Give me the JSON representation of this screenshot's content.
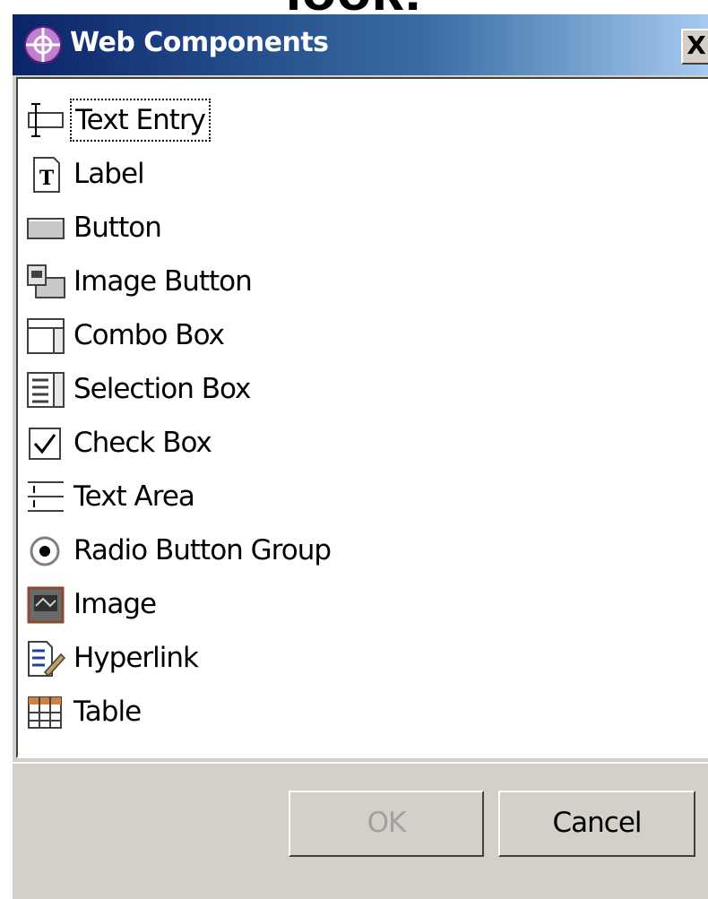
{
  "heading": {
    "text": "look!"
  },
  "window": {
    "title": "Web Components",
    "close_label": "X",
    "title_icon": "globe-icon"
  },
  "components": [
    {
      "label": "Text Entry",
      "icon": "text-entry-icon",
      "selected": true
    },
    {
      "label": "Label",
      "icon": "label-icon",
      "selected": false
    },
    {
      "label": "Button",
      "icon": "button-icon",
      "selected": false
    },
    {
      "label": "Image Button",
      "icon": "image-button-icon",
      "selected": false
    },
    {
      "label": "Combo Box",
      "icon": "combo-box-icon",
      "selected": false
    },
    {
      "label": "Selection Box",
      "icon": "selection-box-icon",
      "selected": false
    },
    {
      "label": "Check Box",
      "icon": "check-box-icon",
      "selected": false
    },
    {
      "label": "Text Area",
      "icon": "text-area-icon",
      "selected": false
    },
    {
      "label": "Radio Button Group",
      "icon": "radio-button-icon",
      "selected": false
    },
    {
      "label": "Image",
      "icon": "image-icon",
      "selected": false
    },
    {
      "label": "Hyperlink",
      "icon": "hyperlink-icon",
      "selected": false
    },
    {
      "label": "Table",
      "icon": "table-icon",
      "selected": false
    }
  ],
  "buttons": {
    "ok_label": "OK",
    "ok_enabled": false,
    "cancel_label": "Cancel"
  }
}
